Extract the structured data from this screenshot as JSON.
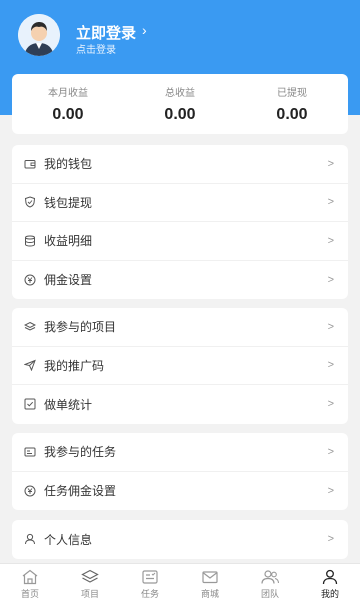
{
  "header": {
    "login_title": "立即登录",
    "login_arrow": "›",
    "login_sub": "点击登录",
    "bg_color": "#3a9af2"
  },
  "stats": [
    {
      "label": "本月收益",
      "value": "0.00"
    },
    {
      "label": "总收益",
      "value": "0.00"
    },
    {
      "label": "已提现",
      "value": "0.00"
    }
  ],
  "groups": [
    {
      "items": [
        {
          "label": "我的钱包",
          "icon": "wallet-icon"
        },
        {
          "label": "钱包提现",
          "icon": "shield-icon"
        },
        {
          "label": "收益明细",
          "icon": "database-icon"
        },
        {
          "label": "佣金设置",
          "icon": "currency-icon"
        }
      ]
    },
    {
      "items": [
        {
          "label": "我参与的项目",
          "icon": "layers-icon"
        },
        {
          "label": "我的推广码",
          "icon": "send-icon"
        },
        {
          "label": "做单统计",
          "icon": "check-square-icon"
        }
      ]
    },
    {
      "items": [
        {
          "label": "我参与的任务",
          "icon": "task-card-icon"
        },
        {
          "label": "任务佣金设置",
          "icon": "currency-icon"
        }
      ]
    },
    {
      "items": [
        {
          "label": "个人信息",
          "icon": "user-icon"
        }
      ]
    }
  ],
  "chevron": ">",
  "tabs": [
    {
      "label": "首页",
      "icon": "home-icon"
    },
    {
      "label": "项目",
      "icon": "layers-icon"
    },
    {
      "label": "任务",
      "icon": "task-icon"
    },
    {
      "label": "商城",
      "icon": "mail-icon"
    },
    {
      "label": "团队",
      "icon": "team-icon"
    },
    {
      "label": "我的",
      "icon": "user-icon",
      "active": true
    }
  ]
}
